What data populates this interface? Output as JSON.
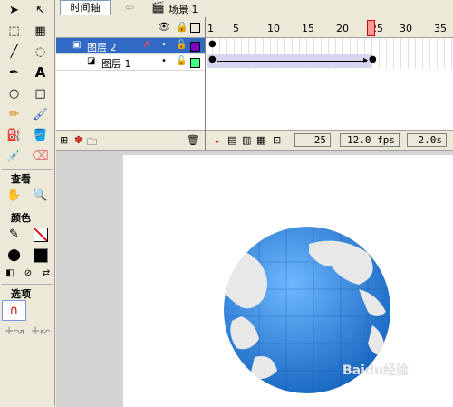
{
  "top": {
    "tab_timeline": "时间轴",
    "scene_label": "场景 1"
  },
  "tools": {
    "view_section": "查看",
    "color_section": "颜色",
    "options_section": "选项"
  },
  "layers": {
    "items": [
      {
        "name": "图层 2",
        "selected": true,
        "outline_color": "#8000c0"
      },
      {
        "name": "图层 1",
        "selected": false,
        "outline_color": "#40ff80"
      }
    ]
  },
  "ruler": {
    "ticks": [
      "1",
      "5",
      "10",
      "15",
      "20",
      "25",
      "30",
      "35"
    ]
  },
  "status": {
    "current_frame": "25",
    "frame_rate": "12.0 fps",
    "elapsed_time": "2.0s"
  },
  "watermark": "Baidu经验",
  "colors": {
    "selection": "#316ac5",
    "playhead": "#cc0000",
    "globe_blue": "#1e88e5"
  }
}
